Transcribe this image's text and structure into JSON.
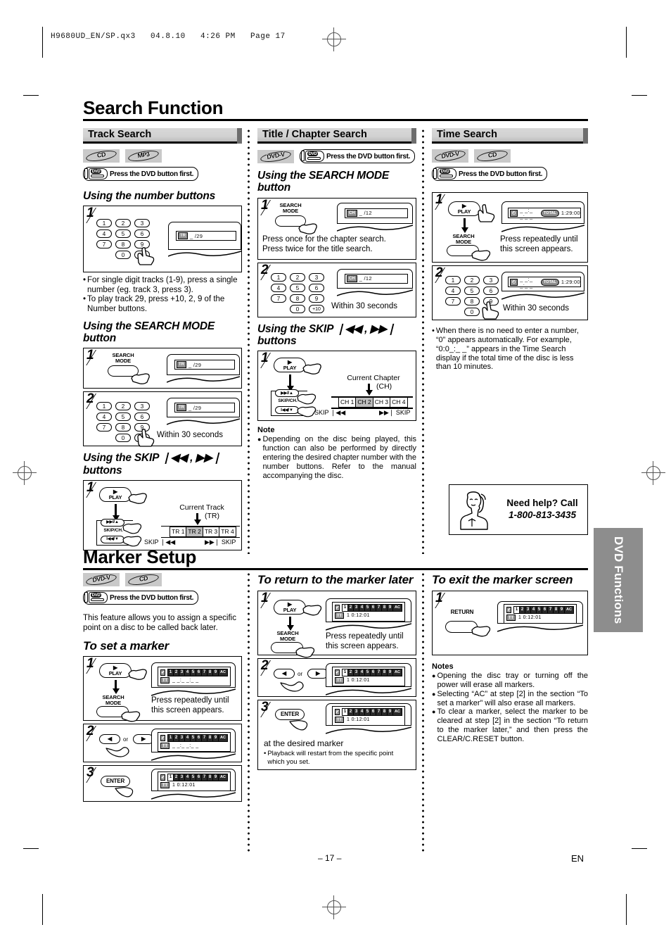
{
  "print_slug": "H9680UD_EN/SP.qx3   04.8.10   4:26 PM   Page 17",
  "page_footer": {
    "page_number": "– 17 –",
    "language": "EN"
  },
  "side_tab": {
    "label": "DVD Functions"
  },
  "press_dvd_note": "Press the DVD button first.",
  "sections": {
    "search": {
      "title": "Search Function",
      "track_search": {
        "header": "Track Search",
        "discs": [
          "CD",
          "MP3"
        ],
        "sub1": "Using the number buttons",
        "step1_num": "1",
        "osd1": {
          "icon": "TR",
          "value": "_ /29"
        },
        "bullets": [
          "For single digit tracks (1-9), press a single number (eg. track 3, press 3).",
          "To play track 29, press +10, 2, 9 of the Number buttons."
        ],
        "sub2": "Using the SEARCH MODE button",
        "s2_step1_num": "1",
        "s2_step1_btn": "SEARCH MODE",
        "s2_osd1": {
          "icon": "TR",
          "value": "_ /29"
        },
        "s2_step2_num": "2",
        "s2_osd2": {
          "icon": "TR",
          "value": "_ /29"
        },
        "s2_step2_text": "Within 30 seconds",
        "sub3": "Using the SKIP ❘◀◀ , ▶▶❘ buttons",
        "s3_step1_num": "1",
        "s3_play": "PLAY",
        "s3_skipch": "SKIP/CH.",
        "s3_caption_line1": "Current Track",
        "s3_caption_line2": "(TR)",
        "s3_cells": [
          "TR 1",
          "TR 2",
          "TR 3",
          "TR 4"
        ],
        "s3_selected_index": 1,
        "s3_skip_left": "SKIP ❘◀◀",
        "s3_skip_right": "▶▶❘ SKIP"
      },
      "title_chapter_search": {
        "header": "Title / Chapter Search",
        "discs": [
          "DVD-V"
        ],
        "sub1": "Using the SEARCH MODE button",
        "step1_num": "1",
        "step1_btn": "SEARCH MODE",
        "osd1": {
          "icon": "CH",
          "value": "_ /12"
        },
        "step1_text_line1": "Press once for the chapter search.",
        "step1_text_line2": "Press twice for the title search.",
        "step2_num": "2",
        "osd2": {
          "icon": "CH",
          "value": "_ /12"
        },
        "step2_text": "Within 30 seconds",
        "sub2": "Using the SKIP ❘◀◀ , ▶▶❘ buttons",
        "s2_step1_num": "1",
        "s2_play": "PLAY",
        "s2_skipch": "SKIP/CH.",
        "s2_caption_line1": "Current Chapter",
        "s2_caption_line2": "(CH)",
        "s2_cells": [
          "CH 1",
          "CH 2",
          "CH 3",
          "CH 4"
        ],
        "s2_selected_index": 1,
        "s2_skip_left": "SKIP ❘◀◀",
        "s2_skip_right": "▶▶❘ SKIP",
        "note_header": "Note",
        "note_body": "Depending on the disc being played, this function can also be performed by directly entering the desired chapter number with the number buttons. Refer to the manual accompanying the disc."
      },
      "time_search": {
        "header": "Time Search",
        "discs": [
          "DVD-V",
          "CD"
        ],
        "step1_num": "1",
        "step1_play": "PLAY",
        "step1_btn": "SEARCH MODE",
        "osd1": {
          "icon": "◴",
          "value": "_ _:_ _:_ _",
          "total_label": "TOTAL",
          "total_value": "1:29:00"
        },
        "step1_text_line1": "Press repeatedly until",
        "step1_text_line2": "this screen appears.",
        "step2_num": "2",
        "osd2": {
          "icon": "◴",
          "value": "_ _:_ _:_ _",
          "total_label": "TOTAL",
          "total_value": "1:29:00"
        },
        "step2_text": "Within 30 seconds",
        "bullet": "When there is no need to enter a number, “0” appears automatically. For example, “0:0_:_ _” appears in the Time Search display if the total time of the disc is less than 10 minutes.",
        "help_line1": "Need help? Call",
        "help_line2": "1-800-813-3435"
      }
    },
    "marker": {
      "title": "Marker Setup",
      "discs": [
        "DVD-V",
        "CD"
      ],
      "intro": "This feature allows you to assign a specific point on a disc to be called back later.",
      "set_marker": {
        "heading": "To set a marker",
        "step1_num": "1",
        "step1_play": "PLAY",
        "step1_btn": "SEARCH MODE",
        "step1_text_line1": "Press repeatedly until",
        "step1_text_line2": "this screen appears.",
        "step2_num": "2",
        "step2_or": "or",
        "step3_num": "3",
        "step3_btn": "ENTER",
        "marker_cells": [
          "1",
          "2",
          "3",
          "4",
          "5",
          "6",
          "7",
          "8",
          "9",
          "AC"
        ],
        "marker_time_blank": "_ _:_ _:_ _",
        "marker_time_set": "1  0:12:01",
        "tt_tag": "TT"
      },
      "return_marker": {
        "heading": "To return to the marker later",
        "step1_num": "1",
        "step1_play": "PLAY",
        "step1_btn": "SEARCH MODE",
        "step1_text_line1": "Press repeatedly until",
        "step1_text_line2": "this screen appears.",
        "step2_num": "2",
        "step2_or": "or",
        "step3_num": "3",
        "step3_btn": "ENTER",
        "step3_text": "at the desired marker",
        "step3_bullet": "Playback will restart from the specific point which you set."
      },
      "exit_marker": {
        "heading": "To exit the marker screen",
        "step1_num": "1",
        "step1_btn": "RETURN"
      },
      "notes_header": "Notes",
      "notes": [
        "Opening the disc tray or turning off the power will erase all markers.",
        "Selecting “AC” at step [2] in the section “To set a marker” will also erase all markers.",
        "To clear a marker, select the marker to be cleared at step [2] in the section “To return to the marker later,”  and then press the CLEAR/C.RESET button."
      ]
    }
  }
}
